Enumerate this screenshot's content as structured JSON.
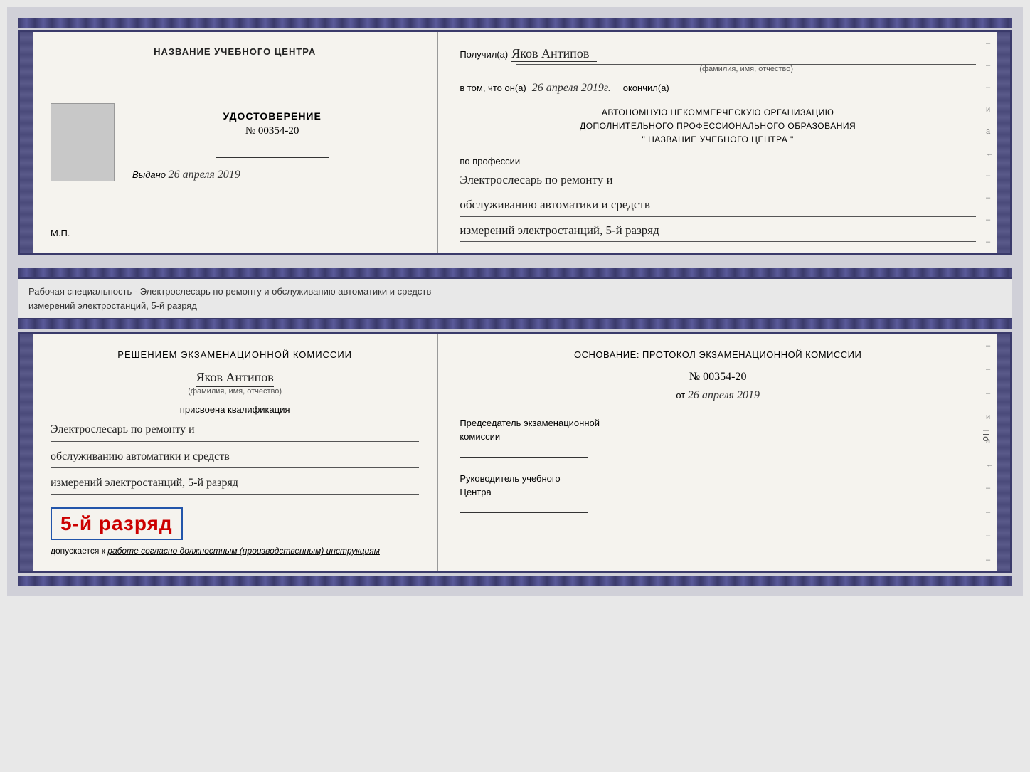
{
  "top_certificate": {
    "left_page": {
      "org_name": "НАЗВАНИЕ УЧЕБНОГО ЦЕНТРА",
      "cert_title": "УДОСТОВЕРЕНИЕ",
      "cert_number": "№ 00354-20",
      "issued_label": "Выдано",
      "issued_date": "26 апреля 2019",
      "mp_label": "М.П."
    },
    "right_page": {
      "received_label": "Получил(а)",
      "recipient_name": "Яков Антипов",
      "fio_label": "(фамилия, имя, отчество)",
      "vtom_label": "в том, что он(а)",
      "vtom_date": "26 апреля 2019г.",
      "okonchil_label": "окончил(а)",
      "org_line1": "АВТОНОМНУЮ НЕКОММЕРЧЕСКУЮ ОРГАНИЗАЦИЮ",
      "org_line2": "ДОПОЛНИТЕЛЬНОГО ПРОФЕССИОНАЛЬНОГО ОБРАЗОВАНИЯ",
      "org_line3": "\"   НАЗВАНИЕ УЧЕБНОГО ЦЕНТРА   \"",
      "po_professii": "по профессии",
      "profession_line1": "Электрослесарь по ремонту и",
      "profession_line2": "обслуживанию автоматики и средств",
      "profession_line3": "измерений электростанций, 5-й разряд",
      "dash_labels": [
        "-",
        "-",
        "-",
        "и",
        "а",
        "←",
        "-",
        "-",
        "-",
        "-"
      ]
    }
  },
  "middle_strip": {
    "text_part1": "Рабочая специальность - Электрослесарь по ремонту и обслуживанию автоматики и средств",
    "text_part2": "измерений электростанций, 5-й разряд"
  },
  "bottom_certificate": {
    "left_page": {
      "resolution_line1": "Решением  экзаменационной  комиссии",
      "fio_name": "Яков Антипов",
      "fio_label": "(фамилия, имя, отчество)",
      "qualification_label": "присвоена квалификация",
      "qual_line1": "Электрослесарь по ремонту и",
      "qual_line2": "обслуживанию автоматики и средств",
      "qual_line3": "измерений электростанций, 5-й разряд",
      "rank_text": "5-й разряд",
      "dopuskaetsya_text": "допускается к",
      "dopuskaetsya_italic": "работе согласно должностным (производственным) инструкциям"
    },
    "right_page": {
      "osnovaniye_text": "Основание: протокол экзаменационной  комиссии",
      "protocol_number": "№  00354-20",
      "ot_label": "от",
      "protocol_date": "26 апреля 2019",
      "chair_line1": "Председатель экзаменационной",
      "chair_line2": "комиссии",
      "rukovoditel_line1": "Руководитель учебного",
      "rukovoditel_line2": "Центра",
      "dash_labels": [
        "-",
        "-",
        "-",
        "и",
        "а",
        "←",
        "-",
        "-",
        "-",
        "-"
      ]
    }
  },
  "ito_text": "ITo"
}
